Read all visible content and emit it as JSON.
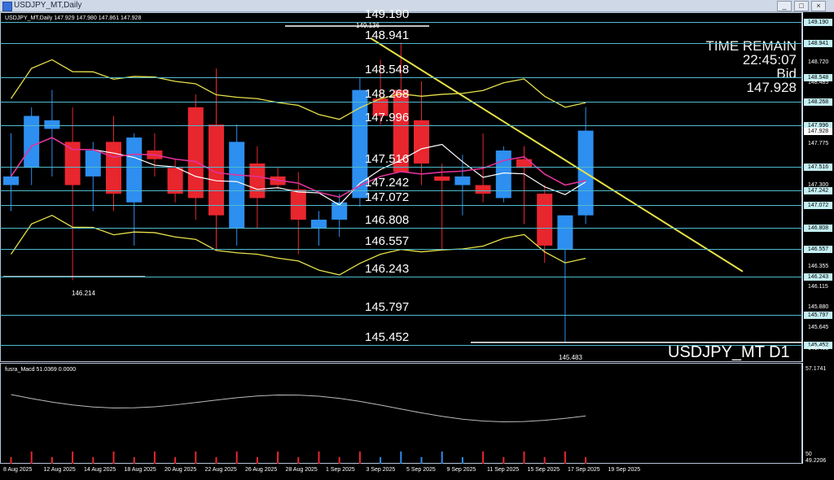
{
  "window": {
    "title": "USDJPY_MT,Daily",
    "minimize": "_",
    "maximize": "□",
    "close": "×"
  },
  "chart": {
    "info": "USDJPY_MT,Daily  147.929 147.980 147.861 147.928",
    "time_remain_label": "TIME REMAIN",
    "time_remain": "22:45:07",
    "bid_label": "Bid",
    "bid": "147.928",
    "symbol": "USDJPY_MT D1",
    "low_label_left": "146.214",
    "low_label_right": "145.483",
    "high_label": "149.136",
    "macd_title": "fusra_Macd 51.0369  0.0000"
  },
  "pivot_levels": [
    {
      "value": "149.190"
    },
    {
      "value": "148.941"
    },
    {
      "value": "148.548"
    },
    {
      "value": "148.268"
    },
    {
      "value": "147.996"
    },
    {
      "value": "147.516"
    },
    {
      "value": "147.242"
    },
    {
      "value": "147.072"
    },
    {
      "value": "146.808"
    },
    {
      "value": "146.557"
    },
    {
      "value": "146.243"
    },
    {
      "value": "145.797"
    },
    {
      "value": "145.452"
    }
  ],
  "price_axis": {
    "boxes": [
      "149.190",
      "148.941",
      "148.548",
      "148.268",
      "147.996",
      "147.928",
      "147.516",
      "147.242",
      "147.072",
      "146.808",
      "146.557",
      "146.243",
      "145.797",
      "145.452"
    ],
    "ticks": [
      "148.720",
      "148.485",
      "147.775",
      "147.300",
      "146.355",
      "146.115",
      "145.880",
      "145.645",
      "145.405"
    ]
  },
  "sub_axis": {
    "top": "57.1741",
    "bottom_a": "50",
    "bottom_b": "49.2206"
  },
  "dates": [
    "8 Aug 2025",
    "12 Aug 2025",
    "14 Aug 2025",
    "18 Aug 2025",
    "20 Aug 2025",
    "22 Aug 2025",
    "26 Aug 2025",
    "28 Aug 2025",
    "1 Sep 2025",
    "3 Sep 2025",
    "5 Sep 2025",
    "9 Sep 2025",
    "11 Sep 2025",
    "15 Sep 2025",
    "17 Sep 2025",
    "19 Sep 2025"
  ],
  "candles": [
    {
      "o": 147.3,
      "h": 147.9,
      "l": 147.0,
      "c": 147.4
    },
    {
      "o": 147.5,
      "h": 148.2,
      "l": 147.3,
      "c": 148.1
    },
    {
      "o": 147.95,
      "h": 148.4,
      "l": 147.4,
      "c": 148.05
    },
    {
      "o": 147.8,
      "h": 148.2,
      "l": 146.2,
      "c": 147.3
    },
    {
      "o": 147.4,
      "h": 147.8,
      "l": 147.0,
      "c": 147.7
    },
    {
      "o": 147.8,
      "h": 148.1,
      "l": 147.0,
      "c": 147.2
    },
    {
      "o": 147.1,
      "h": 147.9,
      "l": 146.6,
      "c": 147.85
    },
    {
      "o": 147.7,
      "h": 147.9,
      "l": 147.4,
      "c": 147.6
    },
    {
      "o": 147.5,
      "h": 147.6,
      "l": 147.1,
      "c": 147.2
    },
    {
      "o": 148.2,
      "h": 148.35,
      "l": 146.9,
      "c": 147.15
    },
    {
      "o": 148.0,
      "h": 148.65,
      "l": 146.55,
      "c": 146.95
    },
    {
      "o": 146.8,
      "h": 148.0,
      "l": 146.6,
      "c": 147.8
    },
    {
      "o": 147.55,
      "h": 147.75,
      "l": 146.8,
      "c": 147.15
    },
    {
      "o": 147.4,
      "h": 147.5,
      "l": 147.25,
      "c": 147.3
    },
    {
      "o": 147.25,
      "h": 147.45,
      "l": 146.5,
      "c": 146.9
    },
    {
      "o": 146.8,
      "h": 147.0,
      "l": 146.6,
      "c": 146.9
    },
    {
      "o": 146.9,
      "h": 147.2,
      "l": 146.7,
      "c": 147.1
    },
    {
      "o": 147.15,
      "h": 148.55,
      "l": 147.05,
      "c": 148.4
    },
    {
      "o": 148.3,
      "h": 148.75,
      "l": 148.0,
      "c": 148.1
    },
    {
      "o": 148.4,
      "h": 148.95,
      "l": 147.45,
      "c": 147.45
    },
    {
      "o": 148.05,
      "h": 148.5,
      "l": 147.3,
      "c": 147.55
    },
    {
      "o": 147.4,
      "h": 147.55,
      "l": 146.55,
      "c": 147.35
    },
    {
      "o": 147.3,
      "h": 147.65,
      "l": 146.95,
      "c": 147.4
    },
    {
      "o": 147.3,
      "h": 147.9,
      "l": 147.1,
      "c": 147.2
    },
    {
      "o": 147.15,
      "h": 147.75,
      "l": 147.1,
      "c": 147.7
    },
    {
      "o": 147.6,
      "h": 147.75,
      "l": 146.85,
      "c": 147.5
    },
    {
      "o": 147.2,
      "h": 147.3,
      "l": 146.4,
      "c": 146.6
    },
    {
      "o": 146.55,
      "h": 146.95,
      "l": 145.48,
      "c": 146.95
    },
    {
      "o": 146.95,
      "h": 148.2,
      "l": 146.85,
      "c": 147.93
    }
  ],
  "colors": {
    "bull": "#2d8ff0",
    "bear": "#e8262e",
    "pivot": "#50bccd",
    "trend": "#e6e14a",
    "ma_pink": "#e0329a",
    "ma_white": "#ffffff"
  }
}
